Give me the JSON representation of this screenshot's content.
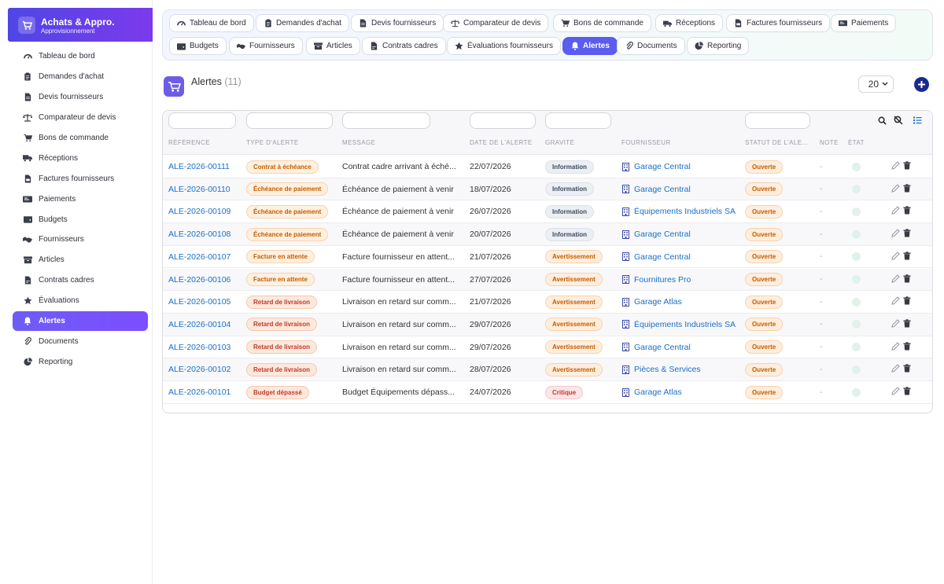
{
  "app": {
    "title": "Achats & Appro.",
    "subtitle": "Approvisionnement"
  },
  "sidebar": {
    "items": [
      {
        "label": "Tableau de bord",
        "icon": "gauge-icon"
      },
      {
        "label": "Demandes d'achat",
        "icon": "clipboard-icon"
      },
      {
        "label": "Devis fournisseurs",
        "icon": "file-icon"
      },
      {
        "label": "Comparateur de devis",
        "icon": "scale-icon"
      },
      {
        "label": "Bons de commande",
        "icon": "cart-icon"
      },
      {
        "label": "Réceptions",
        "icon": "truck-icon"
      },
      {
        "label": "Factures fournisseurs",
        "icon": "file-invoice-icon"
      },
      {
        "label": "Paiements",
        "icon": "money-icon"
      },
      {
        "label": "Budgets",
        "icon": "wallet-icon"
      },
      {
        "label": "Fournisseurs",
        "icon": "handshake-icon"
      },
      {
        "label": "Articles",
        "icon": "boxes-icon"
      },
      {
        "label": "Contrats cadres",
        "icon": "contract-icon"
      },
      {
        "label": "Évaluations",
        "icon": "star-icon"
      },
      {
        "label": "Alertes",
        "icon": "bell-icon",
        "active": true
      },
      {
        "label": "Documents",
        "icon": "paperclip-icon"
      },
      {
        "label": "Reporting",
        "icon": "pie-chart-icon"
      }
    ]
  },
  "tabs": [
    {
      "label": "Tableau de bord",
      "icon": "gauge-icon"
    },
    {
      "label": "Demandes d'achat",
      "icon": "clipboard-icon"
    },
    {
      "label": "Devis fournisseurs",
      "icon": "file-icon"
    },
    {
      "label": "Comparateur de devis",
      "icon": "scale-icon"
    },
    {
      "label": "Bons de commande",
      "icon": "cart-icon"
    },
    {
      "label": "Réceptions",
      "icon": "truck-icon"
    },
    {
      "label": "Factures fournisseurs",
      "icon": "file-invoice-icon"
    },
    {
      "label": "Paiements",
      "icon": "money-icon"
    },
    {
      "label": "Budgets",
      "icon": "wallet-icon"
    },
    {
      "label": "Fournisseurs",
      "icon": "handshake-icon"
    },
    {
      "label": "Articles",
      "icon": "boxes-icon"
    },
    {
      "label": "Contrats cadres",
      "icon": "contract-icon"
    },
    {
      "label": "Évaluations fournisseurs",
      "icon": "star-icon"
    },
    {
      "label": "Alertes",
      "icon": "bell-icon",
      "active": true
    },
    {
      "label": "Documents",
      "icon": "paperclip-icon"
    },
    {
      "label": "Reporting",
      "icon": "pie-chart-icon"
    }
  ],
  "page": {
    "title": "Alertes",
    "count": "(11)",
    "per_page": "20"
  },
  "table": {
    "columns": [
      "Référence",
      "Type d'alerte",
      "Message",
      "Date de l'alerte",
      "Gravité",
      "Fournisseur",
      "Statut de l'ale...",
      "Note",
      "État"
    ],
    "rows": [
      {
        "ref": "ALE-2026-00111",
        "type": "Contrat à échéance",
        "message": "Contrat cadre arrivant à éché...",
        "date": "22/07/2026",
        "severity": "Information",
        "supplier": "Garage Central",
        "status": "Ouverte",
        "note": "-"
      },
      {
        "ref": "ALE-2026-00110",
        "type": "Échéance de paiement",
        "message": "Échéance de paiement à venir",
        "date": "18/07/2026",
        "severity": "Information",
        "supplier": "Garage Central",
        "status": "Ouverte",
        "note": "-"
      },
      {
        "ref": "ALE-2026-00109",
        "type": "Échéance de paiement",
        "message": "Échéance de paiement à venir",
        "date": "26/07/2026",
        "severity": "Information",
        "supplier": "Équipements Industriels SA",
        "status": "Ouverte",
        "note": "-"
      },
      {
        "ref": "ALE-2026-00108",
        "type": "Échéance de paiement",
        "message": "Échéance de paiement à venir",
        "date": "20/07/2026",
        "severity": "Information",
        "supplier": "Garage Central",
        "status": "Ouverte",
        "note": "-"
      },
      {
        "ref": "ALE-2026-00107",
        "type": "Facture en attente",
        "message": "Facture fournisseur en attent...",
        "date": "21/07/2026",
        "severity": "Avertissement",
        "supplier": "Garage Central",
        "status": "Ouverte",
        "note": "-"
      },
      {
        "ref": "ALE-2026-00106",
        "type": "Facture en attente",
        "message": "Facture fournisseur en attent...",
        "date": "27/07/2026",
        "severity": "Avertissement",
        "supplier": "Fournitures Pro",
        "status": "Ouverte",
        "note": "-"
      },
      {
        "ref": "ALE-2026-00105",
        "type": "Retard de livraison",
        "message": "Livraison en retard sur comm...",
        "date": "21/07/2026",
        "severity": "Avertissement",
        "supplier": "Garage Atlas",
        "status": "Ouverte",
        "note": "-"
      },
      {
        "ref": "ALE-2026-00104",
        "type": "Retard de livraison",
        "message": "Livraison en retard sur comm...",
        "date": "29/07/2026",
        "severity": "Avertissement",
        "supplier": "Équipements Industriels SA",
        "status": "Ouverte",
        "note": "-"
      },
      {
        "ref": "ALE-2026-00103",
        "type": "Retard de livraison",
        "message": "Livraison en retard sur comm...",
        "date": "29/07/2026",
        "severity": "Avertissement",
        "supplier": "Garage Central",
        "status": "Ouverte",
        "note": "-"
      },
      {
        "ref": "ALE-2026-00102",
        "type": "Retard de livraison",
        "message": "Livraison en retard sur comm...",
        "date": "28/07/2026",
        "severity": "Avertissement",
        "supplier": "Pièces & Services",
        "status": "Ouverte",
        "note": "-"
      },
      {
        "ref": "ALE-2026-00101",
        "type": "Budget dépassé",
        "message": "Budget Équipements dépass...",
        "date": "24/07/2026",
        "severity": "Critique",
        "supplier": "Garage Atlas",
        "status": "Ouverte",
        "note": "-"
      }
    ]
  },
  "colors": {
    "accent": "#5b5cf0",
    "brand_start": "#4f46e5",
    "brand_end": "#7c3aed",
    "link": "#1a6fc7"
  }
}
